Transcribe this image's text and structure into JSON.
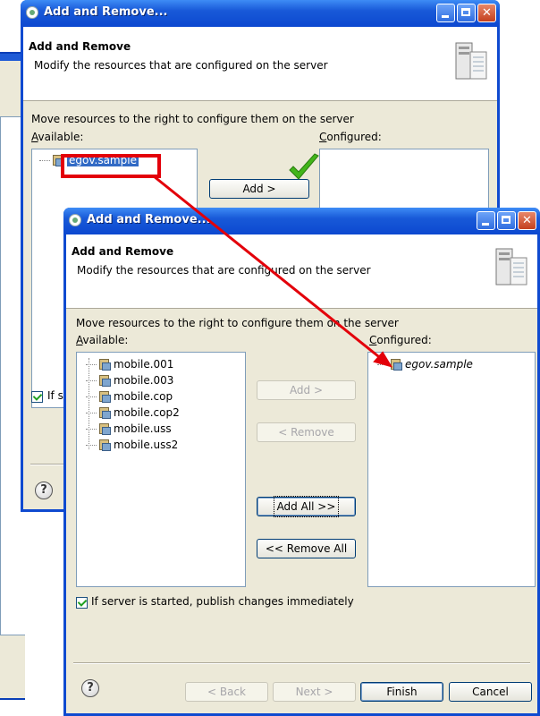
{
  "back_window": {
    "title": "Add and Remove...",
    "header_title": "Add and Remove",
    "header_desc": "Modify the resources that are configured on the server",
    "instruction": "Move resources to the right to configure them on the server",
    "available_label": "Available:",
    "configured_label": "Configured:",
    "available_items": [
      "egov.sample"
    ],
    "add_label": "Add >",
    "publish_label_partial": "If se"
  },
  "front_window": {
    "title": "Add and Remove...",
    "header_title": "Add and Remove",
    "header_desc": "Modify the resources that are configured on the server",
    "instruction": "Move resources to the right to configure them on the server",
    "available_label": "Available:",
    "configured_label": "Configured:",
    "available_items": [
      "mobile.001",
      "mobile.003",
      "mobile.cop",
      "mobile.cop2",
      "mobile.uss",
      "mobile.uss2"
    ],
    "configured_items": [
      "egov.sample"
    ],
    "buttons": {
      "add": "Add >",
      "remove": "< Remove",
      "add_all": "Add All >>",
      "remove_all": "<< Remove All"
    },
    "publish_label": "If server is started, publish changes immediately",
    "footer": {
      "back": "< Back",
      "next": "Next >",
      "finish": "Finish",
      "cancel": "Cancel"
    }
  },
  "colors": {
    "titlebar": "#0c48d0",
    "highlight_box": "#e3000a",
    "arrow": "#e3000a",
    "checkmark": "#42b51a"
  }
}
